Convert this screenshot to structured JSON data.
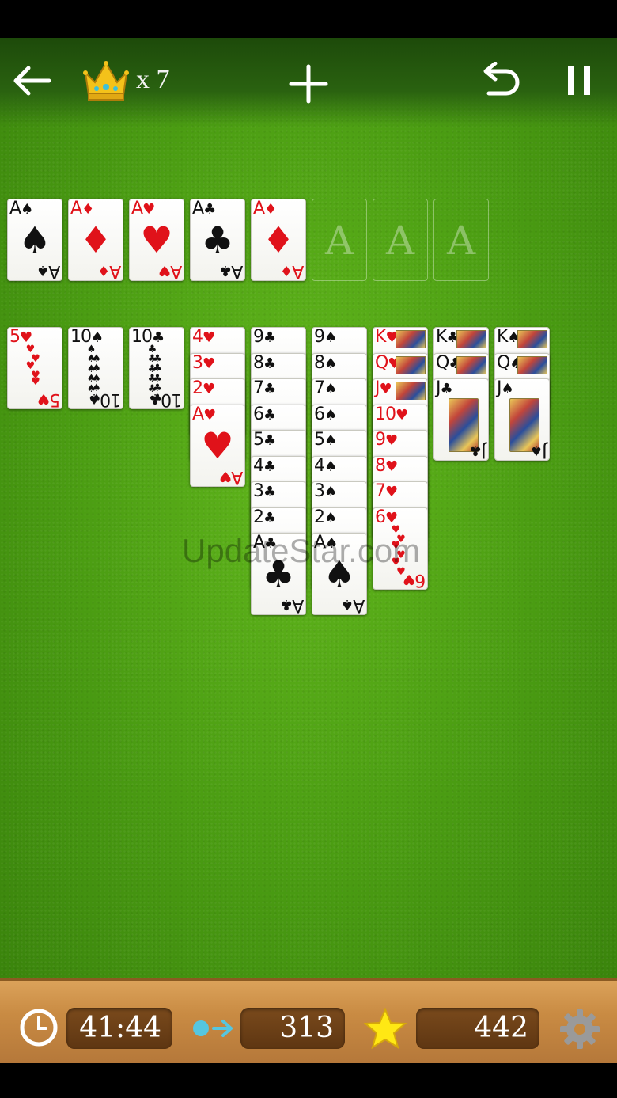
{
  "header": {
    "crown_count": "x 7",
    "icons": [
      "back-arrow-icon",
      "crown-icon",
      "add-icon",
      "undo-icon",
      "pause-icon"
    ]
  },
  "foundations": [
    {
      "rank": "A",
      "suit": "♠",
      "color": "blk"
    },
    {
      "rank": "A",
      "suit": "♦",
      "color": "red"
    },
    {
      "rank": "A",
      "suit": "♥",
      "color": "red"
    },
    {
      "rank": "A",
      "suit": "♣",
      "color": "blk"
    },
    {
      "rank": "A",
      "suit": "♦",
      "color": "red"
    },
    {
      "slot": "A"
    },
    {
      "slot": "A"
    },
    {
      "slot": "A"
    }
  ],
  "tableau": [
    [
      {
        "rank": "5",
        "suit": "♥",
        "color": "red"
      }
    ],
    [
      {
        "rank": "10",
        "suit": "♠",
        "color": "blk"
      }
    ],
    [
      {
        "rank": "10",
        "suit": "♣",
        "color": "blk"
      }
    ],
    [
      {
        "rank": "4",
        "suit": "♥",
        "color": "red"
      },
      {
        "rank": "3",
        "suit": "♥",
        "color": "red"
      },
      {
        "rank": "2",
        "suit": "♥",
        "color": "red"
      },
      {
        "rank": "A",
        "suit": "♥",
        "color": "red"
      }
    ],
    [
      {
        "rank": "9",
        "suit": "♣",
        "color": "blk"
      },
      {
        "rank": "8",
        "suit": "♣",
        "color": "blk"
      },
      {
        "rank": "7",
        "suit": "♣",
        "color": "blk"
      },
      {
        "rank": "6",
        "suit": "♣",
        "color": "blk"
      },
      {
        "rank": "5",
        "suit": "♣",
        "color": "blk"
      },
      {
        "rank": "4",
        "suit": "♣",
        "color": "blk"
      },
      {
        "rank": "3",
        "suit": "♣",
        "color": "blk"
      },
      {
        "rank": "2",
        "suit": "♣",
        "color": "blk"
      },
      {
        "rank": "A",
        "suit": "♣",
        "color": "blk"
      }
    ],
    [
      {
        "rank": "9",
        "suit": "♠",
        "color": "blk"
      },
      {
        "rank": "8",
        "suit": "♠",
        "color": "blk"
      },
      {
        "rank": "7",
        "suit": "♠",
        "color": "blk"
      },
      {
        "rank": "6",
        "suit": "♠",
        "color": "blk"
      },
      {
        "rank": "5",
        "suit": "♠",
        "color": "blk"
      },
      {
        "rank": "4",
        "suit": "♠",
        "color": "blk"
      },
      {
        "rank": "3",
        "suit": "♠",
        "color": "blk"
      },
      {
        "rank": "2",
        "suit": "♠",
        "color": "blk"
      },
      {
        "rank": "A",
        "suit": "♠",
        "color": "blk"
      }
    ],
    [
      {
        "rank": "K",
        "suit": "♥",
        "color": "red",
        "face": true
      },
      {
        "rank": "Q",
        "suit": "♥",
        "color": "red",
        "face": true
      },
      {
        "rank": "J",
        "suit": "♥",
        "color": "red",
        "face": true
      },
      {
        "rank": "10",
        "suit": "♥",
        "color": "red"
      },
      {
        "rank": "9",
        "suit": "♥",
        "color": "red"
      },
      {
        "rank": "8",
        "suit": "♥",
        "color": "red"
      },
      {
        "rank": "7",
        "suit": "♥",
        "color": "red"
      },
      {
        "rank": "6",
        "suit": "♥",
        "color": "red"
      }
    ],
    [
      {
        "rank": "K",
        "suit": "♣",
        "color": "blk",
        "face": true
      },
      {
        "rank": "Q",
        "suit": "♣",
        "color": "blk",
        "face": true
      },
      {
        "rank": "J",
        "suit": "♣",
        "color": "blk",
        "face": true
      }
    ],
    [
      {
        "rank": "K",
        "suit": "♠",
        "color": "blk",
        "face": true
      },
      {
        "rank": "Q",
        "suit": "♠",
        "color": "blk",
        "face": true
      },
      {
        "rank": "J",
        "suit": "♠",
        "color": "blk",
        "face": true
      }
    ]
  ],
  "watermark": "UpdateStar.com",
  "footer": {
    "timer": "41:44",
    "moves": "313",
    "score": "442",
    "icons": [
      "clock-icon",
      "moves-arrow-icon",
      "star-icon",
      "gear-icon"
    ]
  }
}
